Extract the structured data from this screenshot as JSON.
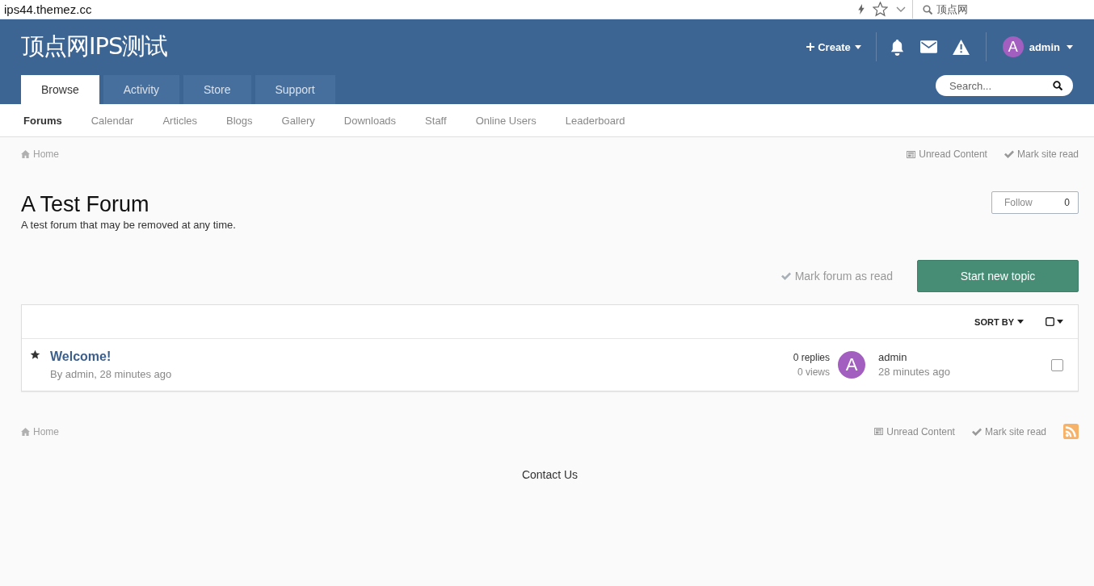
{
  "browser": {
    "url": "ips44.themez.cc",
    "search": "顶点网"
  },
  "header": {
    "site_title": "顶点网IPS测试",
    "create": "Create",
    "user": {
      "avatar_letter": "A",
      "name": "admin"
    },
    "search": {
      "placeholder": "Search..."
    }
  },
  "tabs": [
    {
      "label": "Browse",
      "selected": true
    },
    {
      "label": "Activity",
      "selected": false
    },
    {
      "label": "Store",
      "selected": false
    },
    {
      "label": "Support",
      "selected": false
    }
  ],
  "subnav": [
    {
      "label": "Forums",
      "selected": true
    },
    {
      "label": "Calendar",
      "selected": false
    },
    {
      "label": "Articles",
      "selected": false
    },
    {
      "label": "Blogs",
      "selected": false
    },
    {
      "label": "Gallery",
      "selected": false
    },
    {
      "label": "Downloads",
      "selected": false
    },
    {
      "label": "Staff",
      "selected": false
    },
    {
      "label": "Online Users",
      "selected": false
    },
    {
      "label": "Leaderboard",
      "selected": false
    }
  ],
  "breadcrumb": {
    "home": "Home",
    "unread": "Unread Content",
    "mark_read": "Mark site read"
  },
  "forum": {
    "title": "A Test Forum",
    "description": "A test forum that may be removed at any time.",
    "follow": {
      "label": "Follow",
      "count": "0"
    },
    "mark_forum_read": "Mark forum as read",
    "start_topic": "Start new topic"
  },
  "topic_list": {
    "sort_by": "SORT BY",
    "topics": [
      {
        "featured": true,
        "title": "Welcome!",
        "meta": "By admin, 28 minutes ago",
        "replies": "0 replies",
        "views": "0 views",
        "last_poster": {
          "avatar_letter": "A",
          "name": "admin",
          "time": "28 minutes ago"
        },
        "checked": false
      }
    ]
  },
  "footer_breadcrumb": {
    "home": "Home",
    "unread": "Unread Content",
    "mark_read": "Mark site read"
  },
  "footer": {
    "contact": "Contact Us"
  }
}
